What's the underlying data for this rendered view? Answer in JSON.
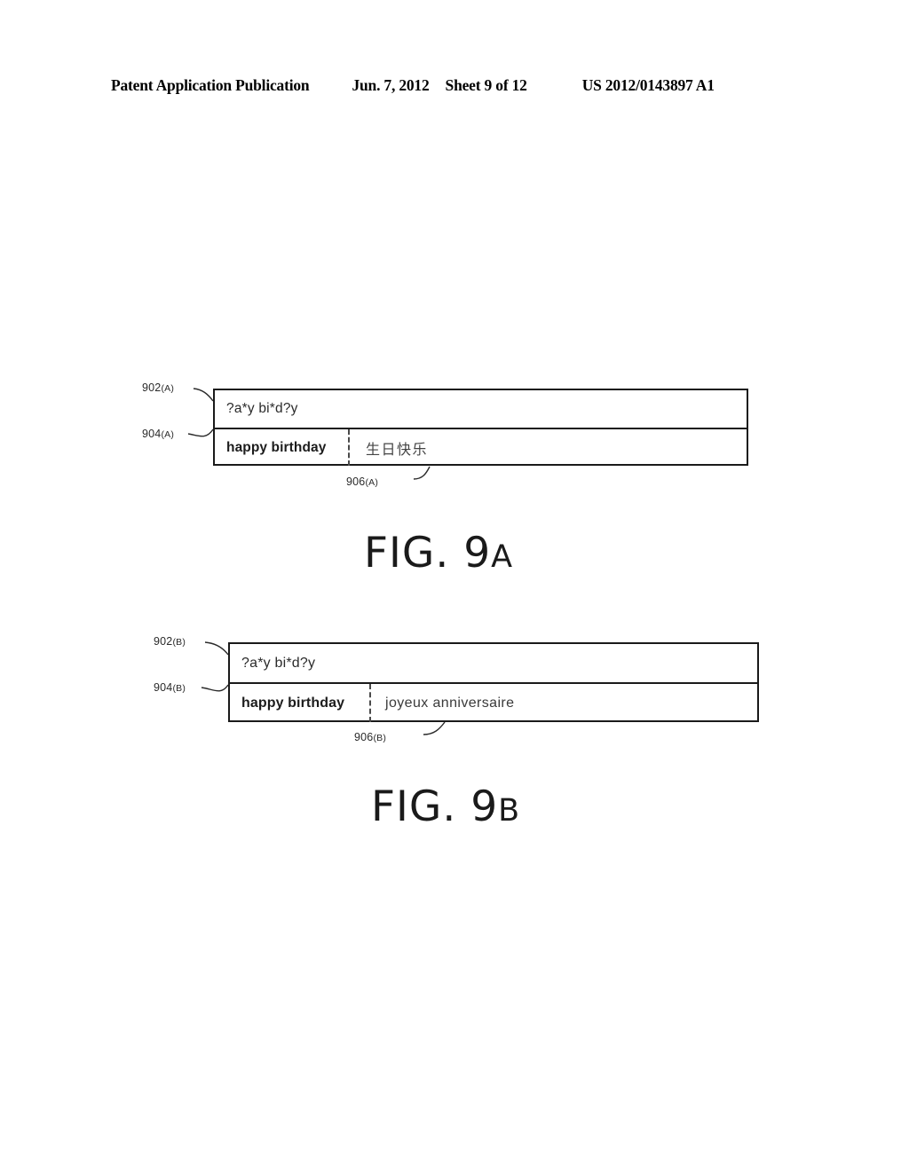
{
  "header": {
    "publication": "Patent Application Publication",
    "date": "Jun. 7, 2012",
    "sheet": "Sheet 9 of 12",
    "patent_number": "US 2012/0143897 A1"
  },
  "figures": [
    {
      "caption_prefix": "FIG. 9",
      "caption_suffix": "A",
      "refs": {
        "query_box": "902",
        "result_row": "904",
        "target_cell": "906",
        "variant": "(A)"
      },
      "query_text": "?a*y bi*d?y",
      "source_text": "happy birthday",
      "target_text": "生日快乐"
    },
    {
      "caption_prefix": "FIG. 9",
      "caption_suffix": "B",
      "refs": {
        "query_box": "902",
        "result_row": "904",
        "target_cell": "906",
        "variant": "(B)"
      },
      "query_text": "?a*y bi*d?y",
      "source_text": "happy birthday",
      "target_text": "joyeux anniversaire"
    }
  ],
  "colors": {
    "ink": "#1a1a1a",
    "paper": "#ffffff",
    "muted_ink": "#3a3a3a"
  }
}
